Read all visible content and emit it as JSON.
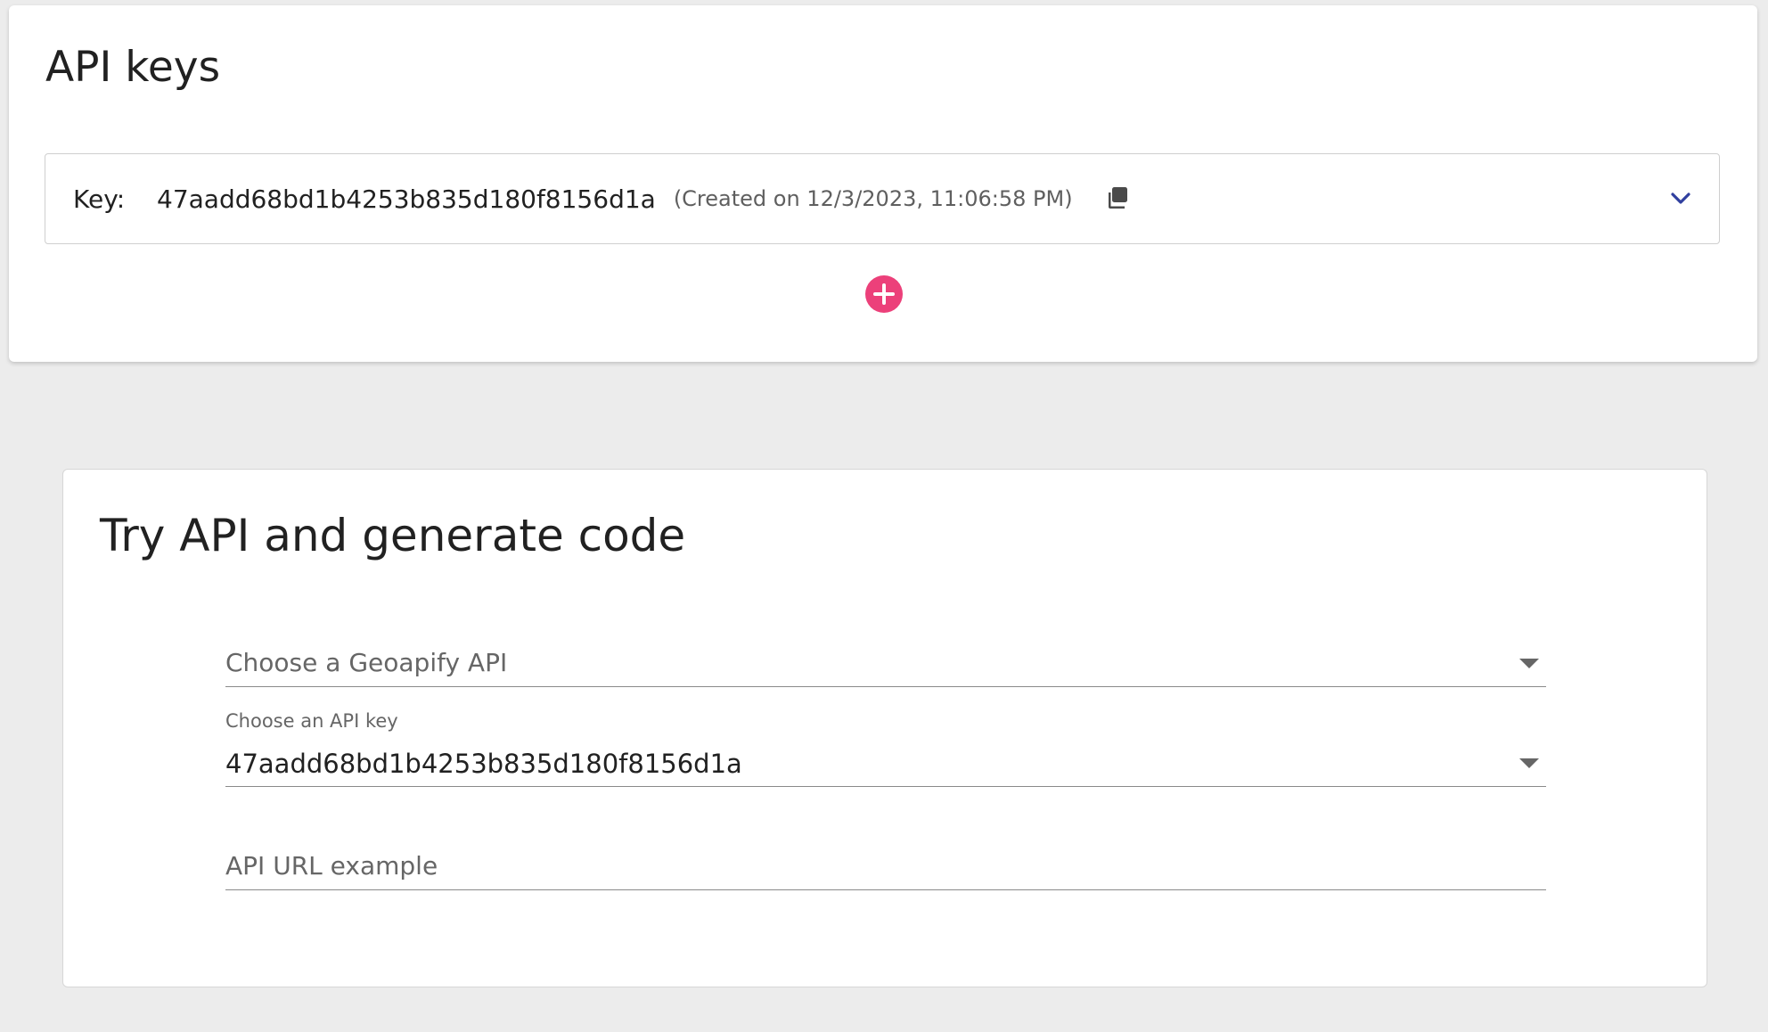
{
  "api_keys": {
    "title": "API keys",
    "key_label": "Key:",
    "key_value": "47aadd68bd1b4253b835d180f8156d1a",
    "created_text": "(Created on 12/3/2023, 11:06:58 PM)",
    "copy_icon": "copy-icon",
    "expand_icon": "chevron-down-icon",
    "add_icon": "plus-icon"
  },
  "try_api": {
    "title": "Try API and generate code",
    "api_select": {
      "placeholder": "Choose a Geoapify API"
    },
    "key_select": {
      "label": "Choose an API key",
      "value": "47aadd68bd1b4253b835d180f8156d1a"
    },
    "url_field": {
      "placeholder": "API URL example"
    }
  },
  "colors": {
    "accent_pink": "#ec407a",
    "chevron_blue": "#303f9f",
    "background": "#ececec"
  }
}
